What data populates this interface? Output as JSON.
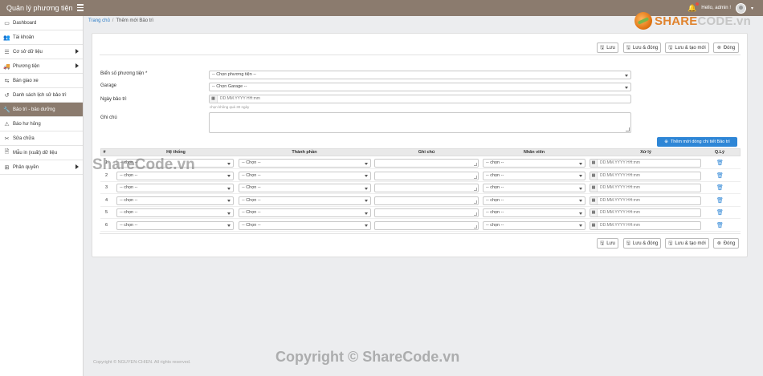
{
  "app": {
    "title": "Quản lý phương tiện",
    "greeting": "Hello, admin !"
  },
  "sidebar": {
    "items": [
      {
        "label": "Dashboard",
        "icon": "monitor-icon",
        "glyph": "▭",
        "has_submenu": false,
        "active": false
      },
      {
        "label": "Tài khoản",
        "icon": "users-icon",
        "glyph": "👥",
        "has_submenu": false,
        "active": false
      },
      {
        "label": "Cơ sở dữ liệu",
        "icon": "list-icon",
        "glyph": "☰",
        "has_submenu": true,
        "active": false
      },
      {
        "label": "Phương tiện",
        "icon": "truck-icon",
        "glyph": "🚚",
        "has_submenu": true,
        "active": false
      },
      {
        "label": "Bàn giao xe",
        "icon": "exchange-icon",
        "glyph": "⇆",
        "has_submenu": false,
        "active": false
      },
      {
        "label": "Danh sách lịch sử bảo trì",
        "icon": "history-icon",
        "glyph": "↺",
        "has_submenu": false,
        "active": false
      },
      {
        "label": "Bảo trì - bảo dưỡng",
        "icon": "wrench-icon",
        "glyph": "🔧",
        "has_submenu": false,
        "active": true
      },
      {
        "label": "Báo hư hỏng",
        "icon": "alert-icon",
        "glyph": "⚠",
        "has_submenu": false,
        "active": false
      },
      {
        "label": "Sửa chữa",
        "icon": "tools-icon",
        "glyph": "✂",
        "has_submenu": false,
        "active": false
      },
      {
        "label": "Mẫu in (xuất) dữ liệu",
        "icon": "file-icon",
        "glyph": "🗎",
        "has_submenu": false,
        "active": false
      },
      {
        "label": "Phân quyền",
        "icon": "sitemap-icon",
        "glyph": "⊞",
        "has_submenu": true,
        "active": false
      }
    ]
  },
  "breadcrumb": {
    "home": "Trang chủ",
    "current": "Thêm mới Bảo trì"
  },
  "logo": {
    "brand_a": "SHARE",
    "brand_b": "CODE",
    "suffix": ".vn"
  },
  "toolbar": {
    "save": "Lưu",
    "save_close": "Lưu & đóng",
    "save_new_top": "Lưu & tạo mới",
    "close": "Đóng",
    "save_new_bottom": "Lưu & tạo mới"
  },
  "form": {
    "plate_label": "Biển số phương tiện *",
    "plate_value": "-- Chọn phương tiện --",
    "garage_label": "Garage",
    "garage_value": "-- Chọn Garage --",
    "date_label": "Ngày bảo trì",
    "date_placeholder": "DD.MM.YYYY HH:mm",
    "date_hint": "chọn không quá 30 ngày",
    "note_label": "Ghi chú"
  },
  "add_detail_button": "Thêm mới dòng chi tiết Bảo trì",
  "table": {
    "headers": {
      "num": "#",
      "system": "Hệ thống",
      "component": "Thành phần",
      "note": "Ghi chú",
      "staff": "Nhân viên",
      "handled": "Xử lý",
      "action": "Q.Lý"
    },
    "rows": [
      {
        "num": "1",
        "system": "-- chọn --",
        "component": "-- Chọn --",
        "staff": "-- chọn --",
        "date": "DD.MM.YYYY HH:mm"
      },
      {
        "num": "2",
        "system": "-- chọn --",
        "component": "-- Chọn --",
        "staff": "-- chọn --",
        "date": "DD.MM.YYYY HH:mm"
      },
      {
        "num": "3",
        "system": "-- chọn --",
        "component": "-- Chọn --",
        "staff": "-- chọn --",
        "date": "DD.MM.YYYY HH:mm"
      },
      {
        "num": "4",
        "system": "-- chọn --",
        "component": "-- Chọn --",
        "staff": "-- chọn --",
        "date": "DD.MM.YYYY HH:mm"
      },
      {
        "num": "5",
        "system": "-- chọn --",
        "component": "-- Chọn --",
        "staff": "-- chọn --",
        "date": "DD.MM.YYYY HH:mm"
      },
      {
        "num": "6",
        "system": "-- chọn --",
        "component": "-- Chọn --",
        "staff": "-- chọn --",
        "date": "DD.MM.YYYY HH:mm"
      }
    ]
  },
  "footer": "Copyright © NGUYEN-CHIEN. All rights reserved.",
  "watermarks": {
    "mid": "ShareCode.vn",
    "bottom": "Copyright © ShareCode.vn"
  },
  "colors": {
    "topbar": "#8b7b6e",
    "accent_blue": "#2e86d6",
    "logo_orange": "#e0832e"
  }
}
